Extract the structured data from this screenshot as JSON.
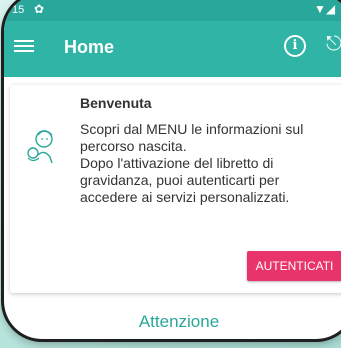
{
  "statusbar": {
    "time": "15",
    "settings_icon": "gear-icon",
    "signal_icon": "wifi-signal-icon"
  },
  "appbar": {
    "title": "Home",
    "menu_icon": "hamburger-menu-icon",
    "info_glyph": "i",
    "logout_icon": "logout-icon"
  },
  "welcome_card": {
    "heading": "Benvenuta",
    "line1": "Scopri dal MENU le informazioni sul percorso nascita.",
    "line2": "Dopo l'attivazione del libretto di gravidanza, puoi autenticarti per accedere ai servizi personalizzati.",
    "button_label": "AUTENTICATI",
    "illustration_icon": "mother-baby-icon"
  },
  "next_section": {
    "title": "Attenzione"
  },
  "colors": {
    "primary": "#2fb4a6",
    "accent": "#e8346b"
  }
}
